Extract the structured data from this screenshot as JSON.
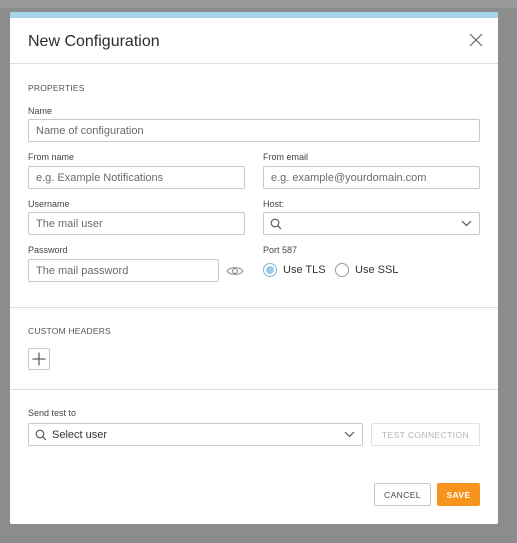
{
  "modal": {
    "title": "New Configuration",
    "accent_color": "#a7d3ec"
  },
  "properties": {
    "section_label": "PROPERTIES",
    "name": {
      "label": "Name",
      "placeholder": "Name of configuration",
      "value": ""
    },
    "from_name": {
      "label": "From name",
      "placeholder": "e.g. Example Notifications",
      "value": ""
    },
    "from_email": {
      "label": "From email",
      "placeholder": "e.g. example@yourdomain.com",
      "value": ""
    },
    "username": {
      "label": "Username",
      "placeholder": "The mail user",
      "value": ""
    },
    "host": {
      "label": "Host:",
      "selected": ""
    },
    "password": {
      "label": "Password",
      "placeholder": "The mail password",
      "value": ""
    },
    "port": {
      "label": "Port 587",
      "options": [
        {
          "label": "Use TLS",
          "checked": true
        },
        {
          "label": "Use SSL",
          "checked": false
        }
      ]
    }
  },
  "custom_headers": {
    "section_label": "CUSTOM HEADERS"
  },
  "send_test": {
    "label": "Send test to",
    "select_text": "Select user",
    "test_button": "TEST CONNECTION"
  },
  "footer": {
    "cancel_label": "CANCEL",
    "save_label": "SAVE",
    "save_color": "#f7941d"
  },
  "icons": {
    "close": "close-icon",
    "search": "search-icon",
    "chevron": "chevron-down-icon",
    "eye": "eye-icon",
    "plus": "plus-icon"
  }
}
